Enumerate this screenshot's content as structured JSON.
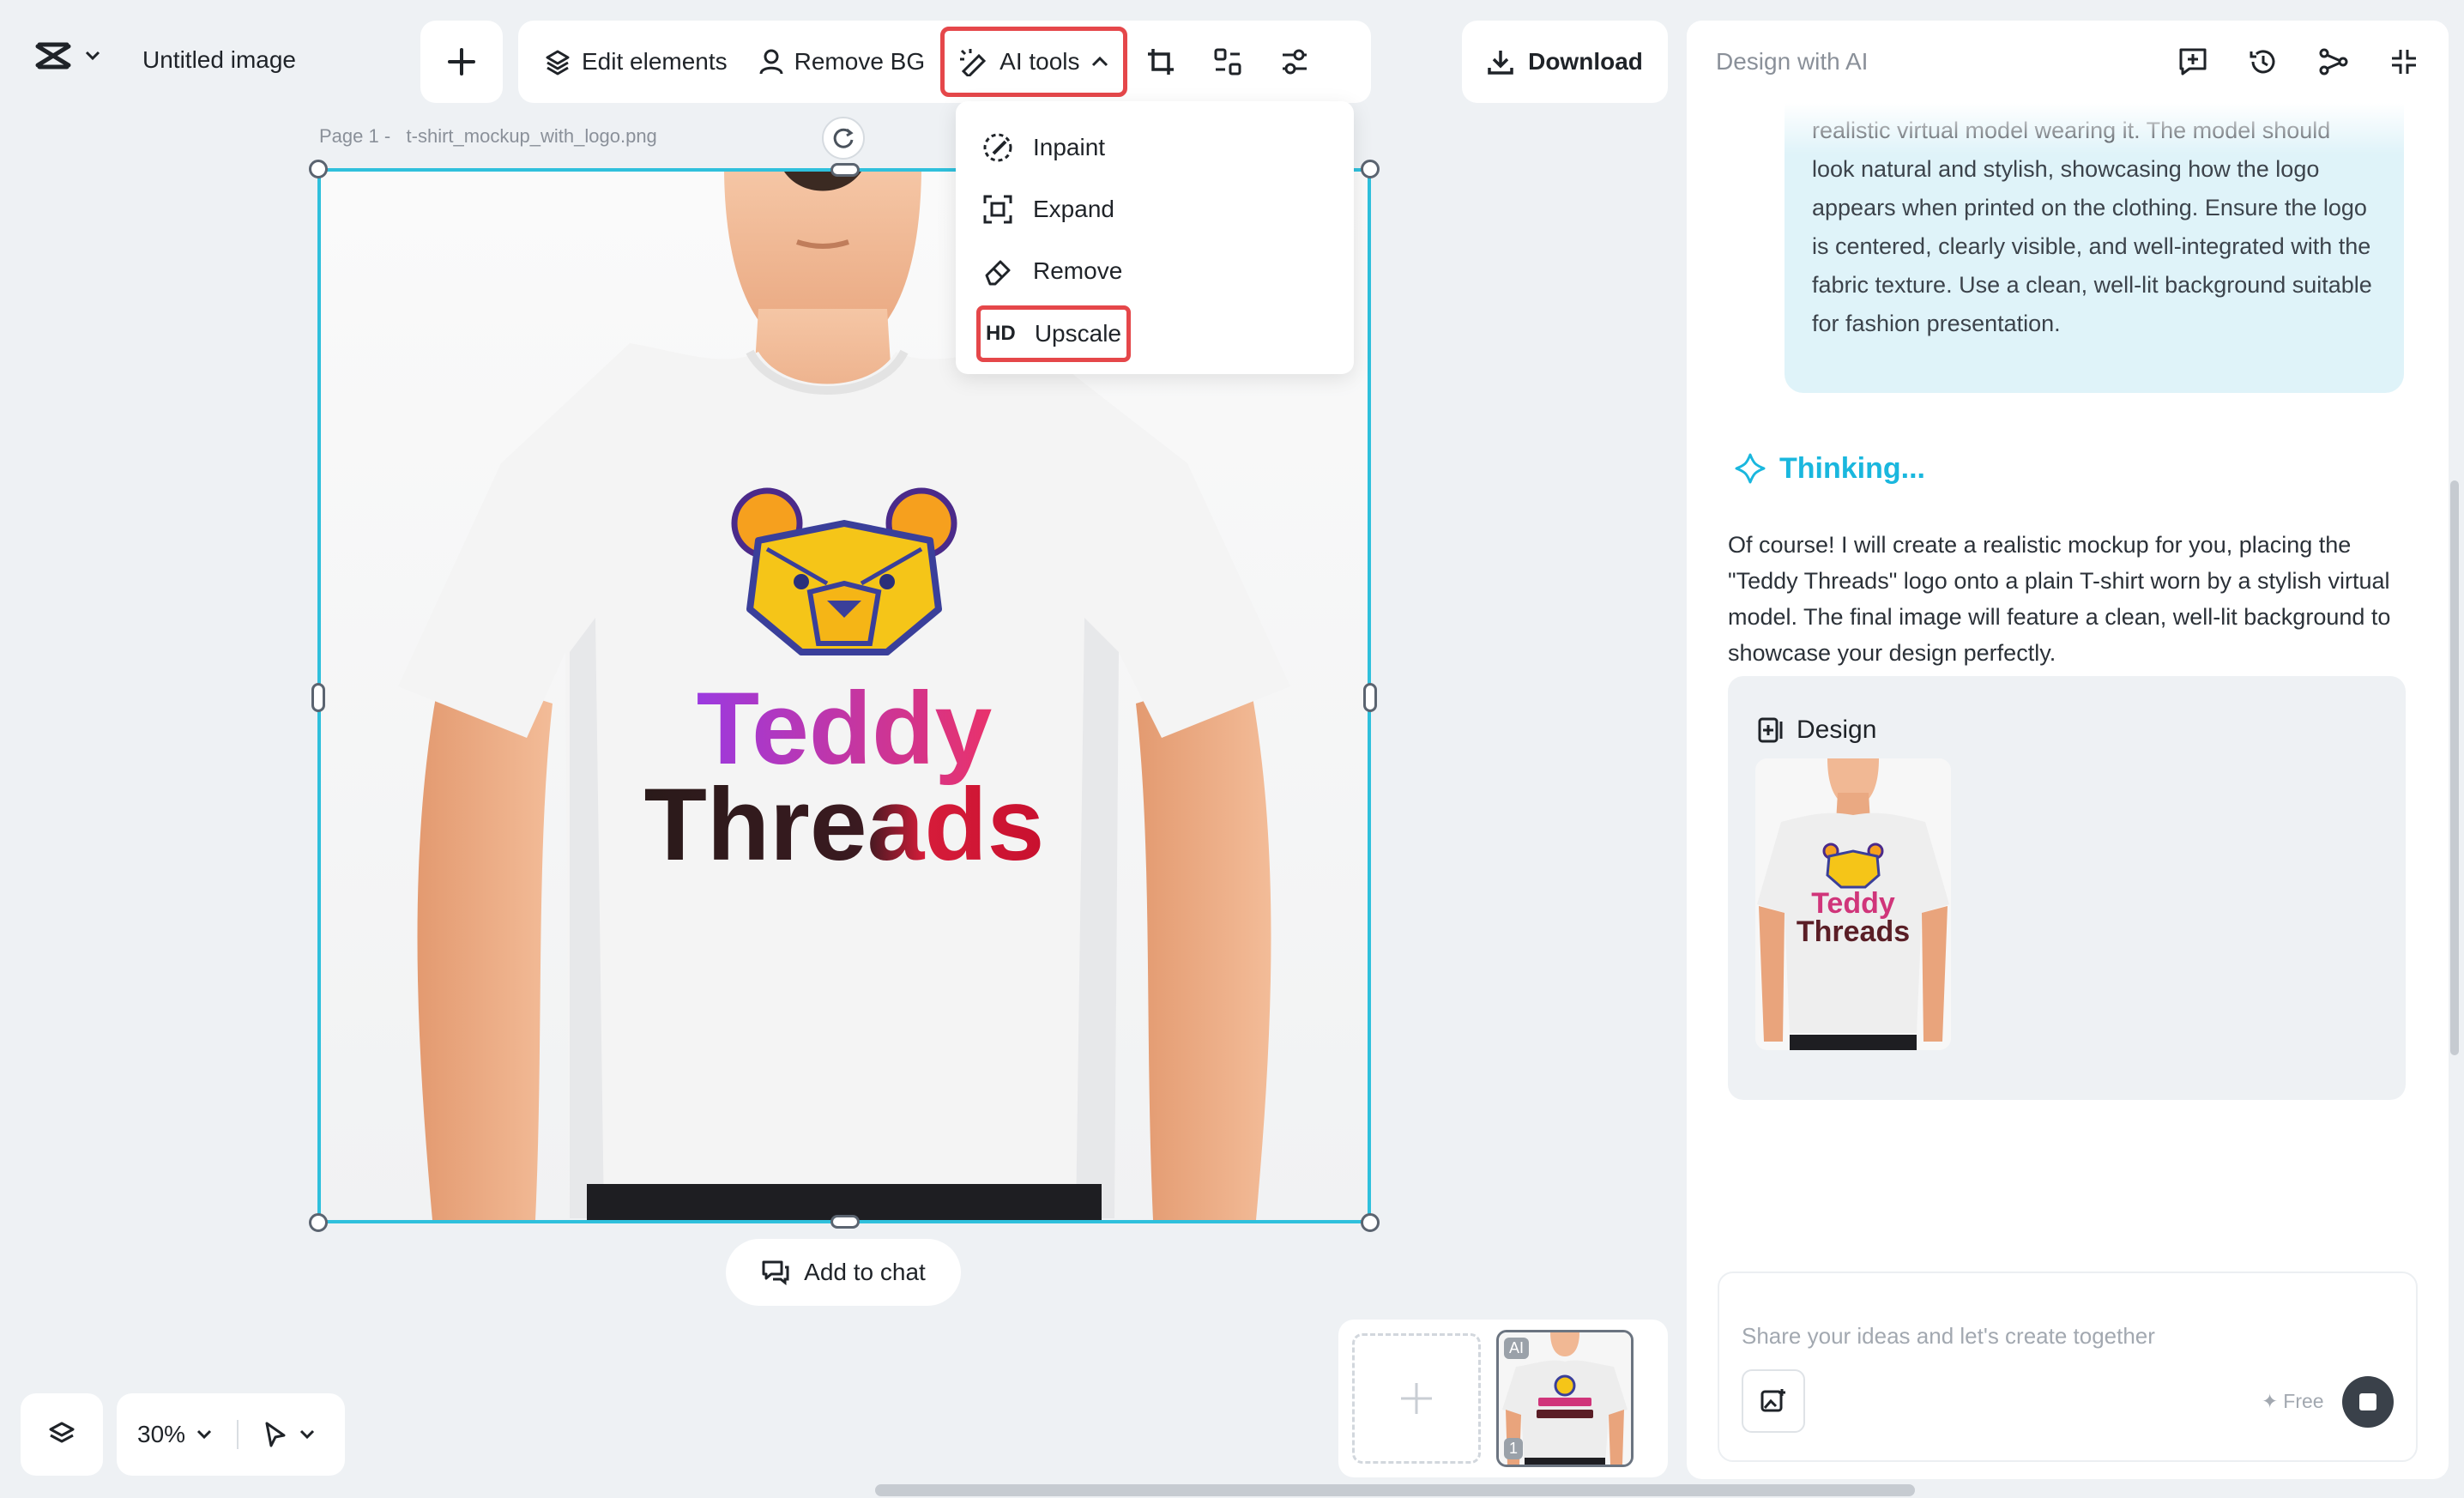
{
  "header": {
    "doc_title": "Untitled image",
    "toolbar": {
      "edit_elements": "Edit elements",
      "remove_bg": "Remove BG",
      "ai_tools": "AI tools"
    },
    "download": "Download"
  },
  "ai_menu": {
    "items": [
      {
        "label": "Inpaint",
        "icon": "inpaint-icon"
      },
      {
        "label": "Expand",
        "icon": "expand-icon"
      },
      {
        "label": "Remove",
        "icon": "eraser-icon"
      },
      {
        "label": "Upscale",
        "icon": "hd-icon",
        "icon_text": "HD"
      }
    ]
  },
  "canvas": {
    "page_label": "Page 1 -",
    "file_name": "t-shirt_mockup_with_logo.png",
    "logo_line1": "Teddy",
    "logo_line2": "Threads",
    "add_to_chat": "Add to chat"
  },
  "bottom_bar": {
    "zoom": "30%"
  },
  "thumbnails": {
    "badge_ai": "AI",
    "badge_page": "1"
  },
  "panel": {
    "title": "Design with AI",
    "user_message": "realistic virtual model wearing it. The model should look natural and stylish, showcasing how the logo appears when printed on the clothing. Ensure the logo is centered, clearly visible, and well-integrated with the fabric texture. Use a clean, well-lit background suitable for fashion presentation.",
    "thinking": "Thinking...",
    "reply": "Of course! I will create a realistic mockup for you, placing the \"Teddy Threads\" logo onto a plain T-shirt worn by a stylish virtual model. The final image will feature a clean, well-lit background to showcase your design perfectly.",
    "design_label": "Design",
    "input_placeholder": "Share your ideas and let's create together",
    "free_label": "Free"
  },
  "colors": {
    "accent_cyan": "#2fc0dc",
    "highlight_red": "#e5474a",
    "thinking_blue": "#1ab7de",
    "user_bubble": "#dff3f9"
  }
}
